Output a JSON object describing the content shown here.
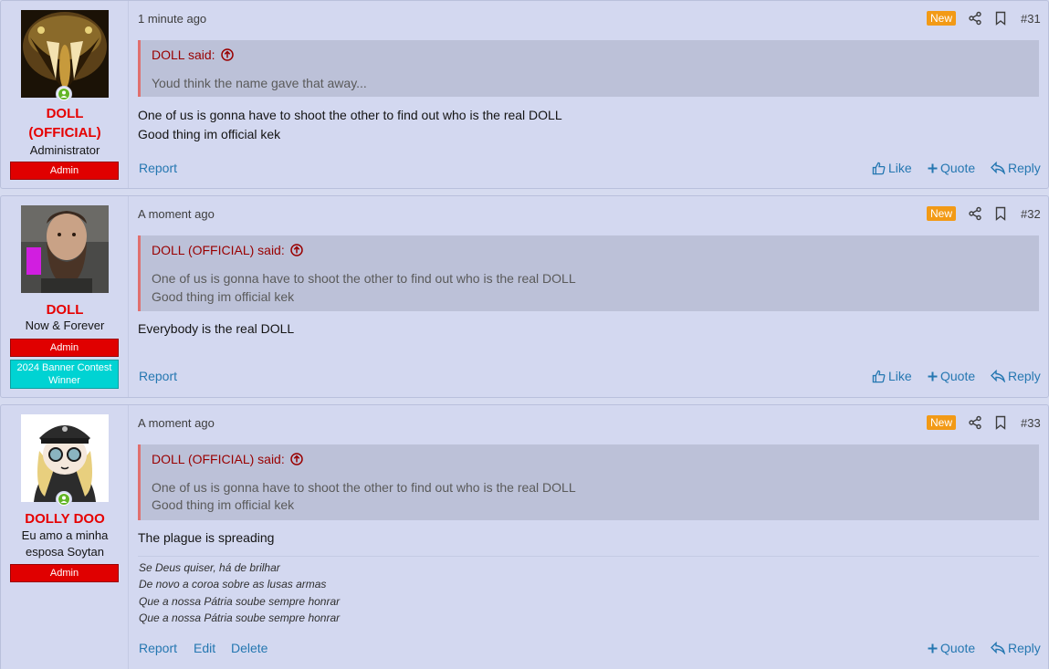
{
  "posts": [
    {
      "user": {
        "name_line1": "DOLL",
        "name_line2": "(OFFICIAL)",
        "title": "Administrator",
        "badges": [
          "Admin"
        ]
      },
      "time": "1 minute ago",
      "new_label": "New",
      "number": "#31",
      "quote": {
        "author": "DOLL said:",
        "lines": [
          "Youd think the name gave that away..."
        ]
      },
      "body": [
        "One of us is gonna have to shoot the other to find out who is the real DOLL",
        "Good thing im official kek"
      ],
      "actions": {
        "report": "Report",
        "like": "Like",
        "quote": "Quote",
        "reply": "Reply"
      }
    },
    {
      "user": {
        "name": "DOLL",
        "title": "Now & Forever",
        "badges": [
          "Admin"
        ],
        "contest_badge": "2024 Banner Contest Winner"
      },
      "time": "A moment ago",
      "new_label": "New",
      "number": "#32",
      "quote": {
        "author": "DOLL (OFFICIAL) said:",
        "lines": [
          "One of us is gonna have to shoot the other to find out who is the real DOLL",
          "Good thing im official kek"
        ]
      },
      "body": [
        "Everybody is the real DOLL"
      ],
      "actions": {
        "report": "Report",
        "like": "Like",
        "quote": "Quote",
        "reply": "Reply"
      }
    },
    {
      "user": {
        "name": "DOLLY DOO",
        "title_line1": "Eu amo a minha",
        "title_line2": "esposa Soytan",
        "badges": [
          "Admin"
        ]
      },
      "time": "A moment ago",
      "new_label": "New",
      "number": "#33",
      "quote": {
        "author": "DOLL (OFFICIAL) said:",
        "lines": [
          "One of us is gonna have to shoot the other to find out who is the real DOLL",
          "Good thing im official kek"
        ]
      },
      "body": [
        "The plague is spreading"
      ],
      "signature": [
        "Se Deus quiser, há de brilhar",
        "De novo a coroa sobre as lusas armas",
        "Que a nossa Pátria soube sempre honrar",
        "Que a nossa Pátria soube sempre honrar"
      ],
      "actions": {
        "report": "Report",
        "edit": "Edit",
        "delete": "Delete",
        "quote": "Quote",
        "reply": "Reply"
      }
    }
  ],
  "colors": {
    "username": "#e60000",
    "link": "#2577b1",
    "new_badge": "#f29a16",
    "admin_badge": "#e00000",
    "contest_badge": "#00d3d3",
    "quote_author": "#990000"
  },
  "icons": [
    "online-status-icon",
    "share-icon",
    "bookmark-icon",
    "up-arrow-circle-icon",
    "thumbs-up-icon",
    "plus-icon",
    "reply-arrow-icon"
  ]
}
